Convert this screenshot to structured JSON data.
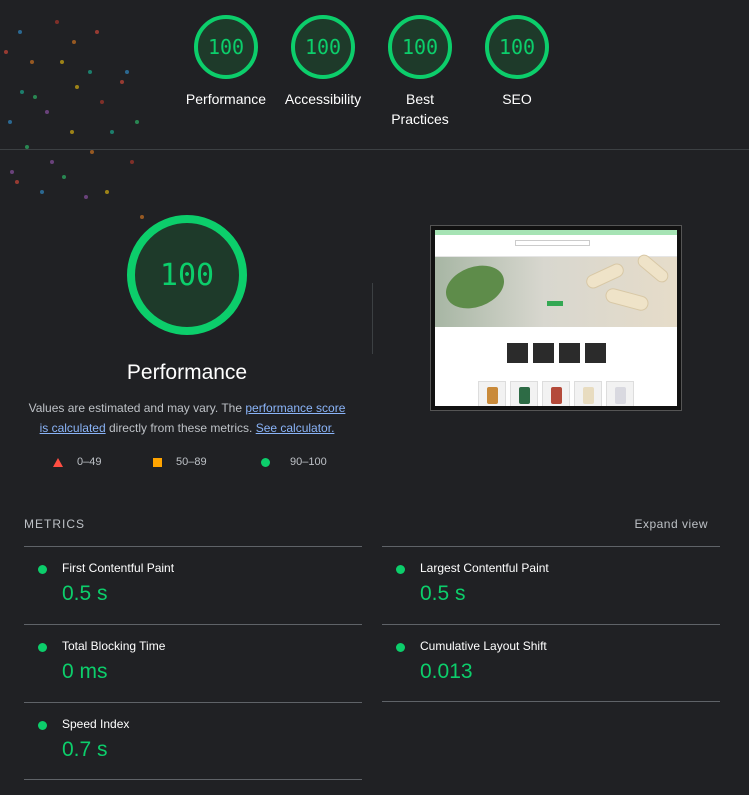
{
  "top_categories": [
    {
      "score": "100",
      "label": "Performance"
    },
    {
      "score": "100",
      "label": "Accessibility"
    },
    {
      "score": "100",
      "label": "Best Practices"
    },
    {
      "score": "100",
      "label": "SEO"
    }
  ],
  "performance": {
    "score": "100",
    "title": "Performance",
    "desc_prefix": "Values are estimated and may vary. The ",
    "link_score": "performance score is calculated",
    "desc_mid": " directly from these metrics. ",
    "link_calc": "See calculator."
  },
  "legend": {
    "fail": "0–49",
    "average": "50–89",
    "pass": "90–100"
  },
  "metrics_section": {
    "header": "METRICS",
    "expand": "Expand view",
    "items": [
      {
        "title": "First Contentful Paint",
        "value": "0.5 s"
      },
      {
        "title": "Largest Contentful Paint",
        "value": "0.5 s"
      },
      {
        "title": "Total Blocking Time",
        "value": "0 ms"
      },
      {
        "title": "Cumulative Layout Shift",
        "value": "0.013"
      },
      {
        "title": "Speed Index",
        "value": "0.7 s"
      }
    ]
  },
  "colors": {
    "pass": "#0cce6b",
    "average": "#ffa400",
    "fail": "#ff4e42",
    "background": "#202124",
    "link": "#8ab4f8"
  }
}
